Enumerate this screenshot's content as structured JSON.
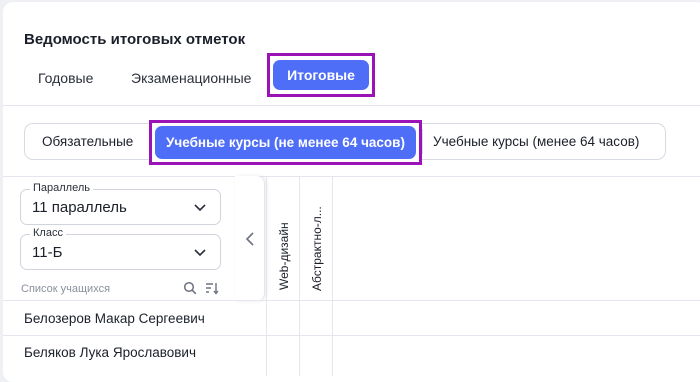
{
  "title": "Ведомость итоговых отметок",
  "tabs": {
    "annual": "Годовые",
    "exam": "Экзаменационные",
    "final": "Итоговые"
  },
  "segments": {
    "mandatory": "Обязательные",
    "long_courses": "Учебные курсы (не менее 64 часов)",
    "short_courses": "Учебные курсы (менее 64 часов)"
  },
  "filters": {
    "parallel_label": "Параллель",
    "parallel_value": "11 параллель",
    "class_label": "Класс",
    "class_value": "11-Б"
  },
  "student_list_label": "Список учащихся",
  "columns": [
    "Web-дизайн",
    "Абстрактно-л..."
  ],
  "students": [
    "Белозеров Макар Сергеевич",
    "Беляков Лука Ярославович"
  ],
  "colors": {
    "accent": "#4f6ef7",
    "highlight_frame": "#9b12b6"
  }
}
